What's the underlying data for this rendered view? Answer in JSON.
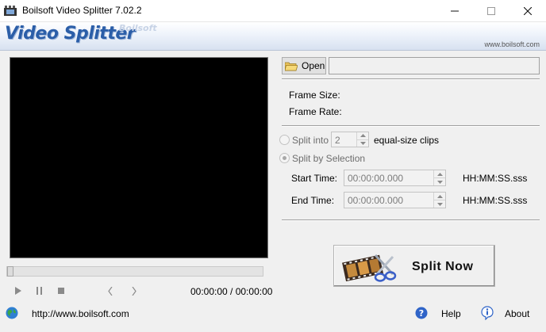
{
  "window": {
    "title": "Boilsoft Video Splitter 7.02.2",
    "controls": {
      "minimize": "—",
      "maximize": "☐",
      "close": "✕"
    }
  },
  "banner": {
    "logo_text": "Video Splitter",
    "brand_text": "Boilsoft",
    "url": "www.boilsoft.com"
  },
  "player": {
    "time_readout": "00:00:00 / 00:00:00",
    "seek_position": 0,
    "controls": {
      "play": "▶",
      "pause": "❚❚",
      "stop": "■",
      "prev": "❬",
      "next": "❭"
    }
  },
  "file": {
    "open_label": "Open",
    "path_value": ""
  },
  "info": {
    "frame_size_label": "Frame Size:",
    "frame_rate_label": "Frame Rate:"
  },
  "split_options": {
    "split_into_label": "Split into",
    "split_into_value": "2",
    "equal_size_label": "equal-size clips",
    "split_by_selection_label": "Split by Selection",
    "selected_mode": "Split by Selection",
    "start_time_label": "Start Time:",
    "start_time_value": "00:00:00.000",
    "end_time_label": "End Time:",
    "end_time_value": "00:00:00.000",
    "time_format": "HH:MM:SS.sss"
  },
  "actions": {
    "split_now_label": "Split Now"
  },
  "footer": {
    "website_link": "http://www.boilsoft.com",
    "help_label": "Help",
    "about_label": "About"
  },
  "colors": {
    "banner_logo": "#2b5ea8",
    "preview_background": "#000000",
    "window_background": "#f0f0f0"
  }
}
